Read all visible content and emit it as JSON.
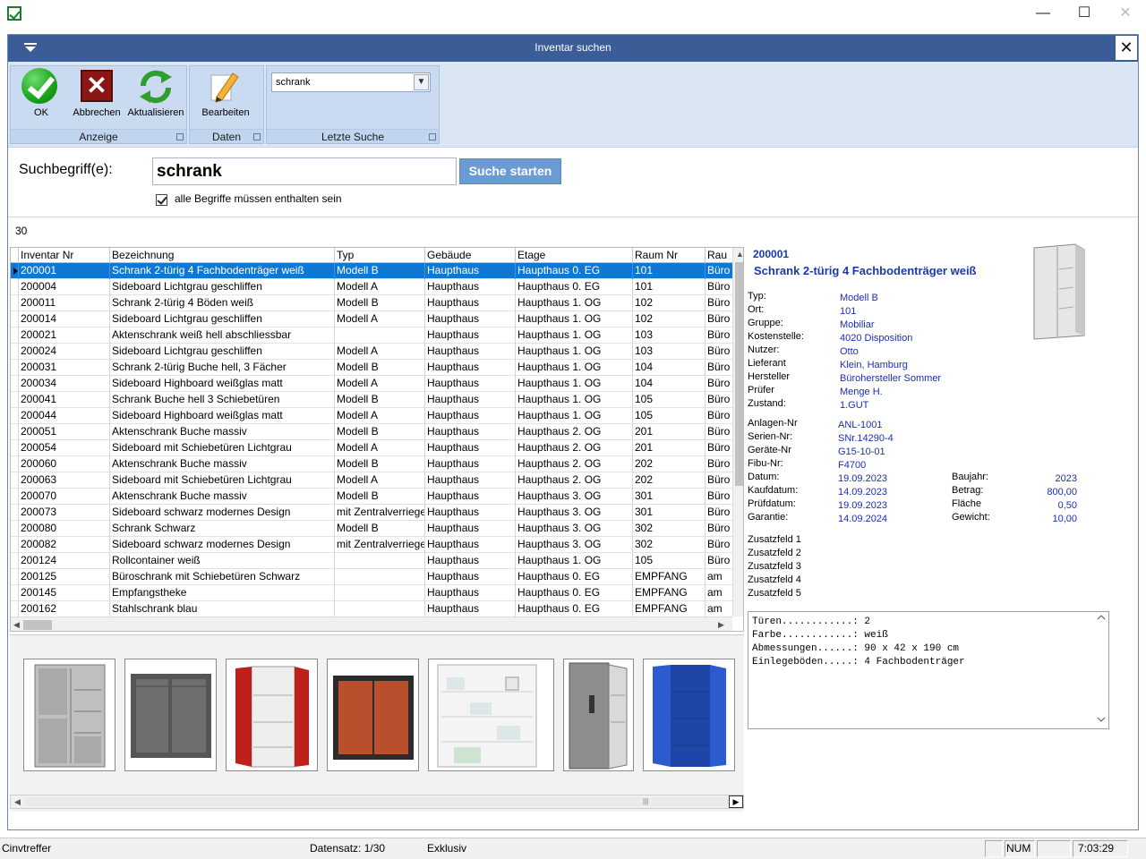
{
  "window": {
    "minimize_glyph": "—",
    "maximize_glyph": "☐",
    "close_glyph": "✕"
  },
  "dialog": {
    "title": "Inventar suchen",
    "close_glyph": "✕"
  },
  "ribbon": {
    "groups": {
      "anzeige": "Anzeige",
      "daten": "Daten",
      "letzte_suche": "Letzte Suche"
    },
    "buttons": {
      "ok": "OK",
      "abbrechen": "Abbrechen",
      "aktualisieren": "Aktualisieren",
      "bearbeiten": "Bearbeiten"
    },
    "recent_search_value": "schrank"
  },
  "search": {
    "label": "Suchbegriff(e):",
    "value": "schrank",
    "button": "Suche starten",
    "checkbox_label": "alle Begriffe müssen enthalten sein",
    "checkbox_checked": true
  },
  "result_count": "30",
  "grid": {
    "columns": [
      "Inventar Nr",
      "Bezeichnung",
      "Typ",
      "Gebäude",
      "Etage",
      "Raum Nr",
      "Rau"
    ],
    "rows": [
      [
        "200001",
        "Schrank 2-türig 4 Fachbodenträger weiß",
        "Modell B",
        "Haupthaus",
        "Haupthaus 0. EG",
        "101",
        "Büro"
      ],
      [
        "200004",
        "Sideboard Lichtgrau geschliffen",
        "Modell A",
        "Haupthaus",
        "Haupthaus 0. EG",
        "101",
        "Büro"
      ],
      [
        "200011",
        "Schrank 2-türig 4 Böden weiß",
        "Modell B",
        "Haupthaus",
        "Haupthaus 1. OG",
        "102",
        "Büro"
      ],
      [
        "200014",
        "Sideboard Lichtgrau geschliffen",
        "Modell A",
        "Haupthaus",
        "Haupthaus 1. OG",
        "102",
        "Büro"
      ],
      [
        "200021",
        "Aktenschrank weiß hell abschliessbar",
        "",
        "Haupthaus",
        "Haupthaus 1. OG",
        "103",
        "Büro"
      ],
      [
        "200024",
        "Sideboard Lichtgrau geschliffen",
        "Modell A",
        "Haupthaus",
        "Haupthaus 1. OG",
        "103",
        "Büro"
      ],
      [
        "200031",
        "Schrank  2-türig Buche hell, 3 Fächer",
        "Modell B",
        "Haupthaus",
        "Haupthaus 1. OG",
        "104",
        "Büro"
      ],
      [
        "200034",
        "Sideboard Highboard weißglas matt",
        "Modell A",
        "Haupthaus",
        "Haupthaus 1. OG",
        "104",
        "Büro"
      ],
      [
        "200041",
        "Schrank Buche hell 3 Schiebetüren",
        "Modell B",
        "Haupthaus",
        "Haupthaus 1. OG",
        "105",
        "Büro"
      ],
      [
        "200044",
        "Sideboard Highboard weißglas matt",
        "Modell A",
        "Haupthaus",
        "Haupthaus 1. OG",
        "105",
        "Büro"
      ],
      [
        "200051",
        "Aktenschrank Buche massiv",
        "Modell B",
        "Haupthaus",
        "Haupthaus 2. OG",
        "201",
        "Büro"
      ],
      [
        "200054",
        "Sideboard mit Schiebetüren Lichtgrau",
        "Modell A",
        "Haupthaus",
        "Haupthaus 2. OG",
        "201",
        "Büro"
      ],
      [
        "200060",
        "Aktenschrank Buche massiv",
        "Modell B",
        "Haupthaus",
        "Haupthaus 2. OG",
        "202",
        "Büro"
      ],
      [
        "200063",
        "Sideboard mit Schiebetüren Lichtgrau",
        "Modell A",
        "Haupthaus",
        "Haupthaus 2. OG",
        "202",
        "Büro"
      ],
      [
        "200070",
        "Aktenschrank Buche massiv",
        "Modell B",
        "Haupthaus",
        "Haupthaus 3. OG",
        "301",
        "Büro"
      ],
      [
        "200073",
        "Sideboard schwarz modernes Design",
        "mit Zentralverriegelung",
        "Haupthaus",
        "Haupthaus 3. OG",
        "301",
        "Büro"
      ],
      [
        "200080",
        "Schrank Schwarz",
        "Modell B",
        "Haupthaus",
        "Haupthaus 3. OG",
        "302",
        "Büro"
      ],
      [
        "200082",
        "Sideboard schwarz modernes Design",
        "mit Zentralverriegelung",
        "Haupthaus",
        "Haupthaus 3. OG",
        "302",
        "Büro"
      ],
      [
        "200124",
        "Rollcontainer weiß",
        "",
        "Haupthaus",
        "Haupthaus 1. OG",
        "105",
        "Büro"
      ],
      [
        "200125",
        "Büroschrank mit Schiebetüren Schwarz",
        "",
        "Haupthaus",
        "Haupthaus 0. EG",
        "EMPFANG",
        "am"
      ],
      [
        "200145",
        "Empfangstheke",
        "",
        "Haupthaus",
        "Haupthaus 0. EG",
        "EMPFANG",
        "am"
      ],
      [
        "200162",
        "Stahlschrank blau",
        "",
        "Haupthaus",
        "Haupthaus 0. EG",
        "EMPFANG",
        "am"
      ]
    ]
  },
  "detail": {
    "id": "200001",
    "name": "Schrank 2-türig 4 Fachbodenträger weiß",
    "fields": [
      [
        "Typ:",
        "Modell B"
      ],
      [
        "Ort:",
        "101"
      ],
      [
        "Gruppe:",
        "Mobiliar"
      ],
      [
        "Kostenstelle:",
        "4020 Disposition"
      ],
      [
        "Nutzer:",
        "Otto"
      ],
      [
        "Lieferant",
        "Klein, Hamburg"
      ],
      [
        "Hersteller",
        "Bürohersteller Sommer"
      ],
      [
        "Prüfer",
        "Menge H."
      ],
      [
        "Zustand:",
        "1.GUT"
      ]
    ],
    "numbers": [
      [
        "Anlagen-Nr",
        "ANL-1001"
      ],
      [
        "Serien-Nr:",
        "SNr.14290-4"
      ],
      [
        "Geräte-Nr",
        "G15-10-01"
      ],
      [
        "Fibu-Nr:",
        "F4700"
      ]
    ],
    "dates": [
      [
        "Datum:",
        "19.09.2023"
      ],
      [
        "Kaufdatum:",
        "14.09.2023"
      ],
      [
        "Prüfdatum:",
        "19.09.2023"
      ],
      [
        "Garantie:",
        "14.09.2024"
      ]
    ],
    "right_values": [
      [
        "Baujahr:",
        "2023"
      ],
      [
        "Betrag:",
        "800,00"
      ],
      [
        "Fläche",
        "0,50"
      ],
      [
        "Gewicht:",
        "10,00"
      ]
    ],
    "extra_fields": [
      "Zusatzfeld 1",
      "Zusatzfeld 2",
      "Zusatzfeld 3",
      "Zusatzfeld 4",
      "Zusatzfeld 5"
    ],
    "memo": "Türen............: 2\nFarbe............: weiß\nAbmessungen......: 90 x 42 x 190 cm\nEinlegeböden.....: 4 Fachbodenträger"
  },
  "statusbar": {
    "left": "Cinvtreffer",
    "datensatz": "Datensatz: 1/30",
    "mode": "Exklusiv",
    "num": "NUM",
    "time": "7:03:29"
  },
  "colors": {
    "accent": "#3b5d97",
    "selection": "#0f78d4",
    "detail_text": "#1b2fb0"
  },
  "icons": [
    "app-check-icon",
    "menu-chevron-icon",
    "ok-check-icon",
    "cancel-x-icon",
    "refresh-icon",
    "pencil-icon",
    "dropdown-arrow-icon"
  ]
}
